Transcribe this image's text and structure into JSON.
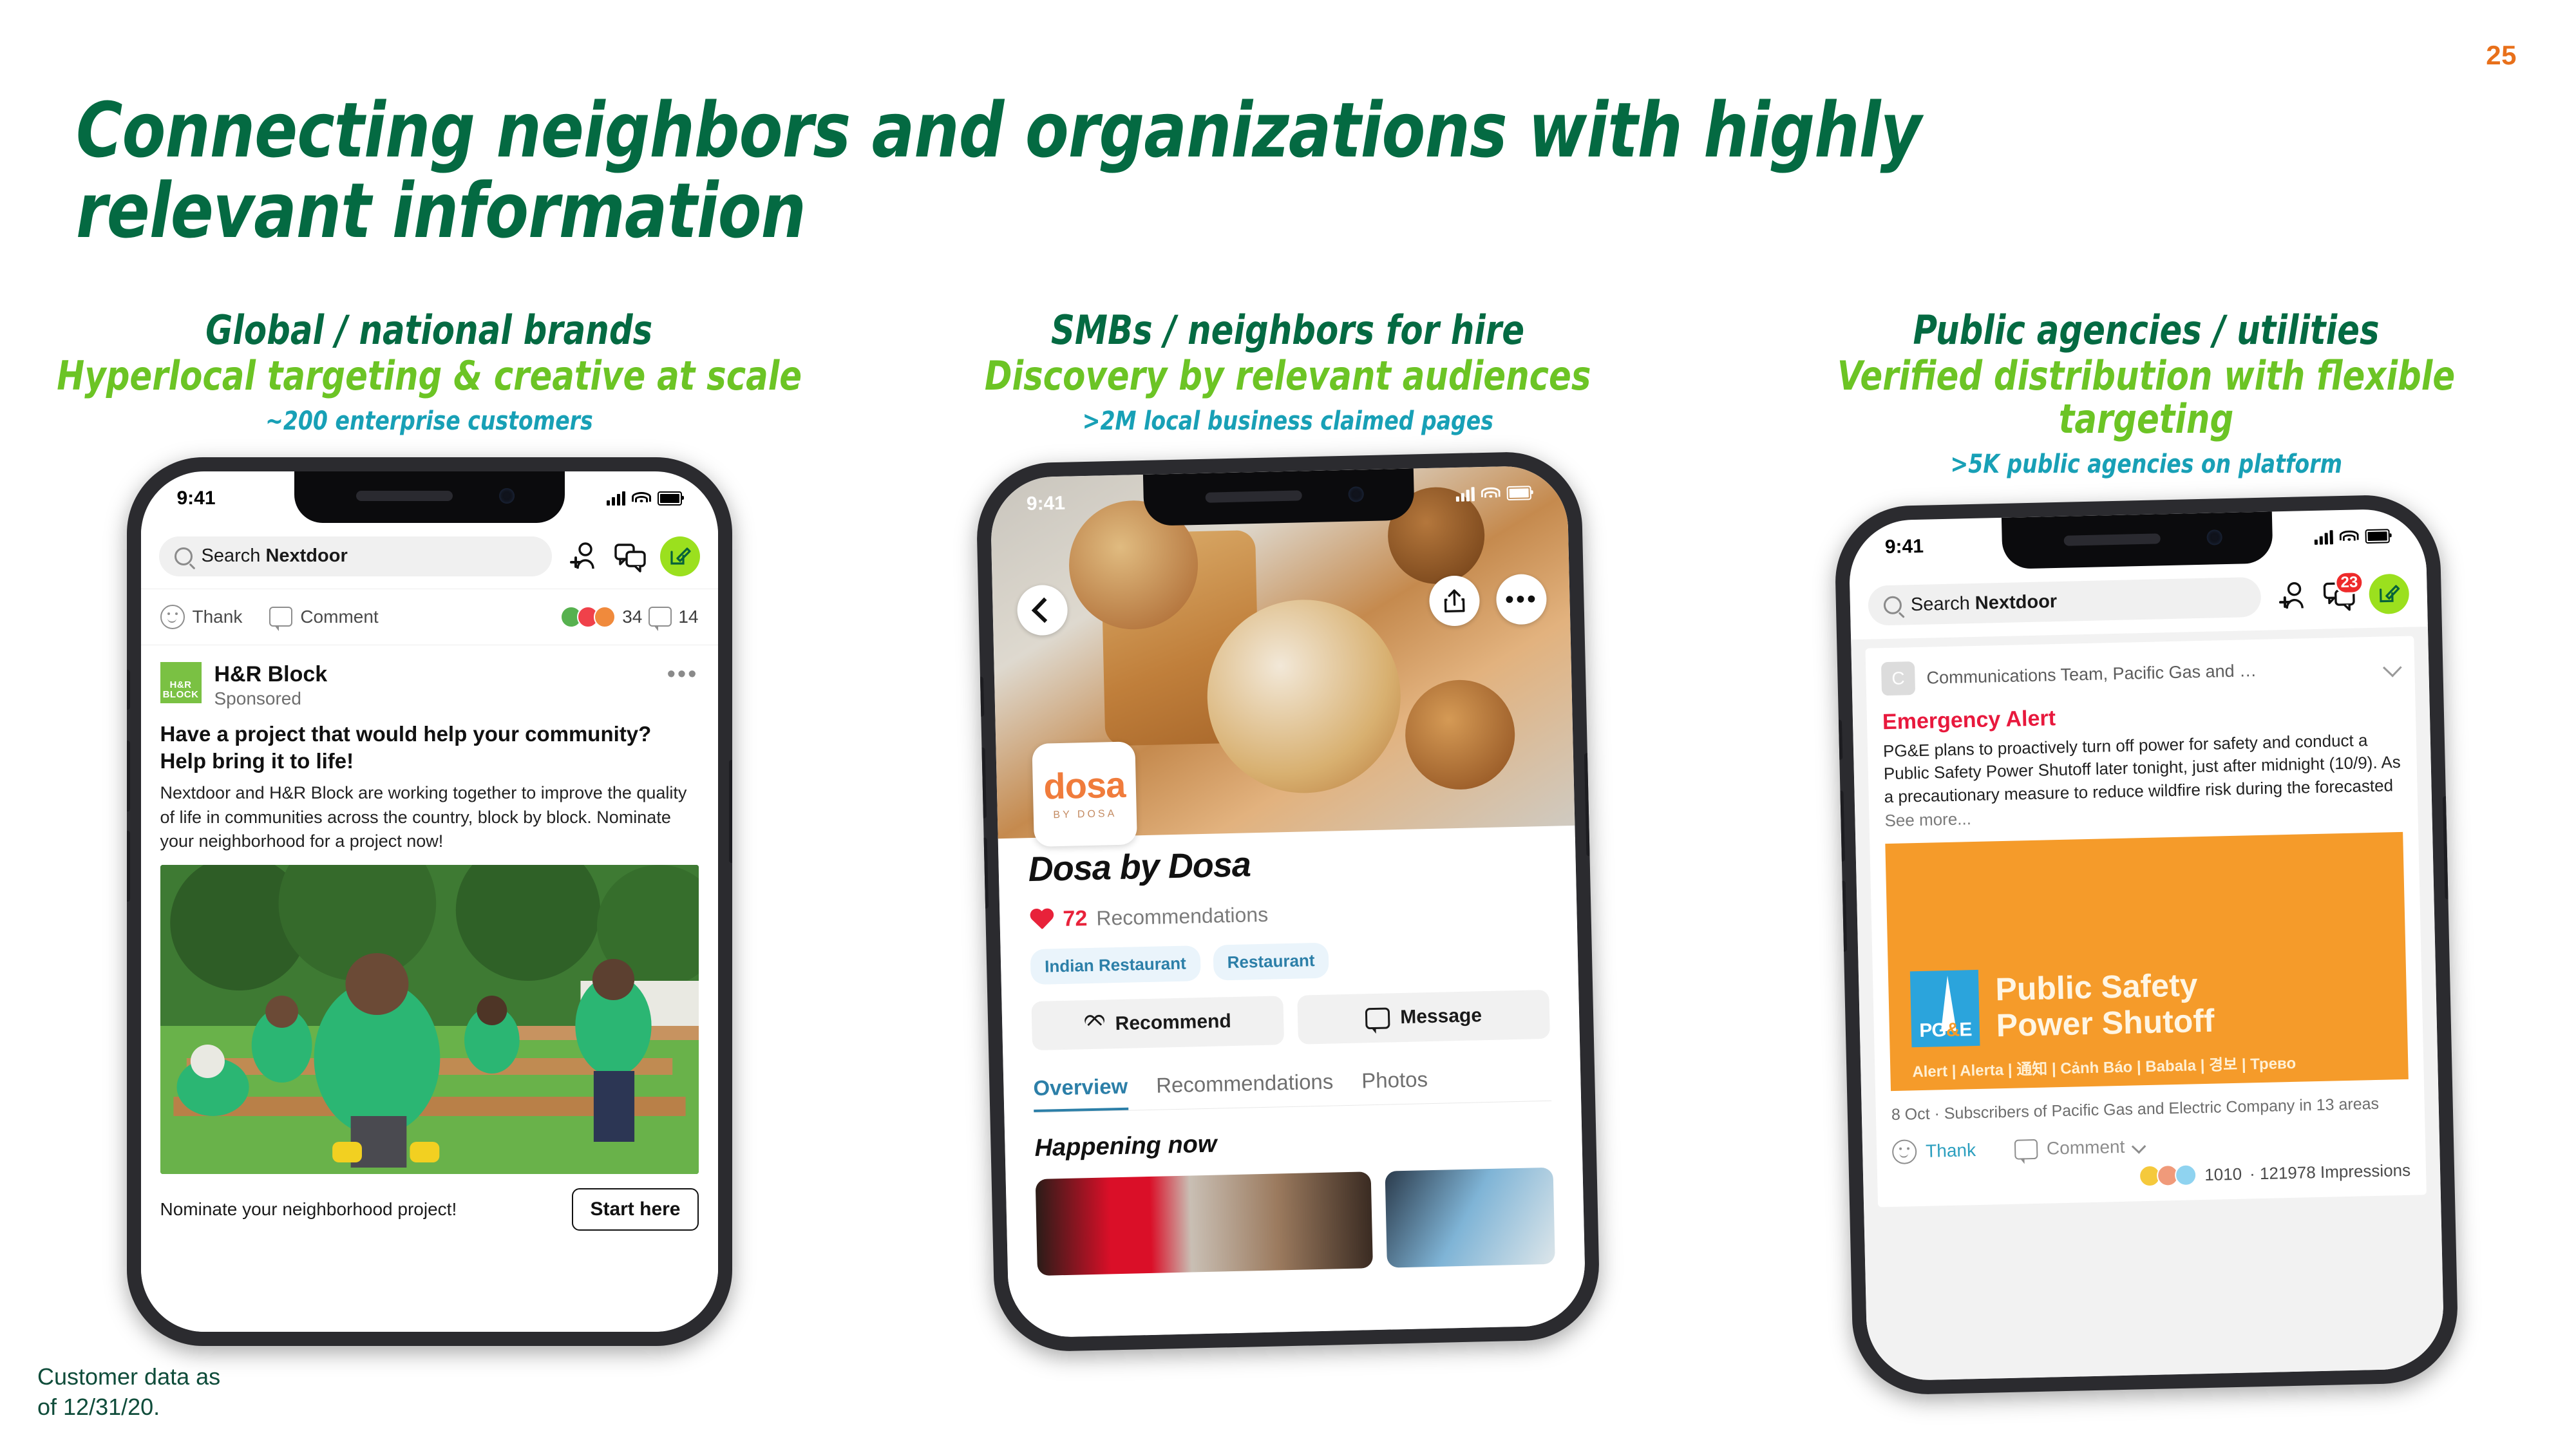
{
  "slide": {
    "page_number": "25",
    "title": "Connecting neighbors and organizations with highly relevant information",
    "footnote": "Customer data as of 12/31/20.",
    "colors": {
      "dark_green": "#046A42",
      "bright_green": "#6CC425",
      "teal": "#18A0B6",
      "orange_page_number": "#E8701A"
    }
  },
  "columns": [
    {
      "heading": "Global / national brands",
      "subheading": "Hyperlocal targeting & creative at scale",
      "stat": "~200 enterprise customers"
    },
    {
      "heading": "SMBs / neighbors for hire",
      "subheading": "Discovery by relevant audiences",
      "stat": ">2M local business claimed pages"
    },
    {
      "heading": "Public agencies / utilities",
      "subheading": "Verified distribution with flexible targeting",
      "stat": ">5K public agencies on platform"
    }
  ],
  "phone1": {
    "status_time": "9:41",
    "search_placeholder_prefix": "Search ",
    "search_placeholder_brand": "Nextdoor",
    "icons": [
      "search-icon",
      "invite-neighbor-icon",
      "chat-icon",
      "compose-icon"
    ],
    "actionbar": {
      "thank_label": "Thank",
      "comment_label": "Comment",
      "reactions_count": "34",
      "comments_count": "14"
    },
    "post": {
      "logo_line1": "H&R",
      "logo_line2": "BLOCK",
      "author": "H&R Block",
      "sponsored_label": "Sponsored",
      "more_icon": "•••",
      "headline": "Have a project that would help your community? Help bring it to life!",
      "body": "Nextdoor and H&R Block are working together to improve the quality of life in communities across the country, block by block. Nominate your neighborhood for a project now!",
      "photo_alt": "Volunteers in green Block t-shirts building raised garden beds",
      "cta_text": "Nominate your neighborhood project!",
      "cta_button": "Start here"
    }
  },
  "phone2": {
    "status_time": "9:41",
    "nav_icons": [
      "back-icon",
      "share-icon",
      "more-icon"
    ],
    "logo_primary": "dosa",
    "logo_secondary": "BY DOSA",
    "business_name": "Dosa by Dosa",
    "recommendations_count": "72",
    "recommendations_label": "Recommendations",
    "tags": [
      "Indian Restaurant",
      "Restaurant"
    ],
    "buttons": [
      {
        "label": "Recommend",
        "icon": "heart-outline-icon"
      },
      {
        "label": "Message",
        "icon": "message-bubble-icon"
      }
    ],
    "tabs": [
      {
        "label": "Overview",
        "active": true
      },
      {
        "label": "Recommendations",
        "active": false
      },
      {
        "label": "Photos",
        "active": false
      }
    ],
    "section_title": "Happening now"
  },
  "phone3": {
    "status_time": "9:41",
    "search_placeholder_prefix": "Search ",
    "search_placeholder_brand": "Nextdoor",
    "chat_badge": "23",
    "post": {
      "avatar_letter": "C",
      "author": "Communications Team, Pacific Gas and …",
      "title": "Emergency Alert",
      "body": "PG&E plans to proactively turn off power for safety and conduct a Public Safety Power Shutoff later tonight, just after midnight (10/9). As a precautionary measure to reduce wildfire risk during the forecasted",
      "see_more": "See more...",
      "banner": {
        "logo_pg": "PG",
        "logo_amp": "&",
        "logo_e": "E",
        "title_line1": "Public Safety",
        "title_line2": "Power Shutoff",
        "languages": "Alert | Alerta | 通知 | Cảnh Báo | Babala | 경보 | Трево",
        "background_color": "#F59B2A"
      },
      "meta": "8 Oct · Subscribers of Pacific Gas and Electric Company in 13 areas",
      "thank_label": "Thank",
      "comment_label": "Comment",
      "reaction_count": "1010",
      "impressions": "· 121978 Impressions"
    }
  }
}
